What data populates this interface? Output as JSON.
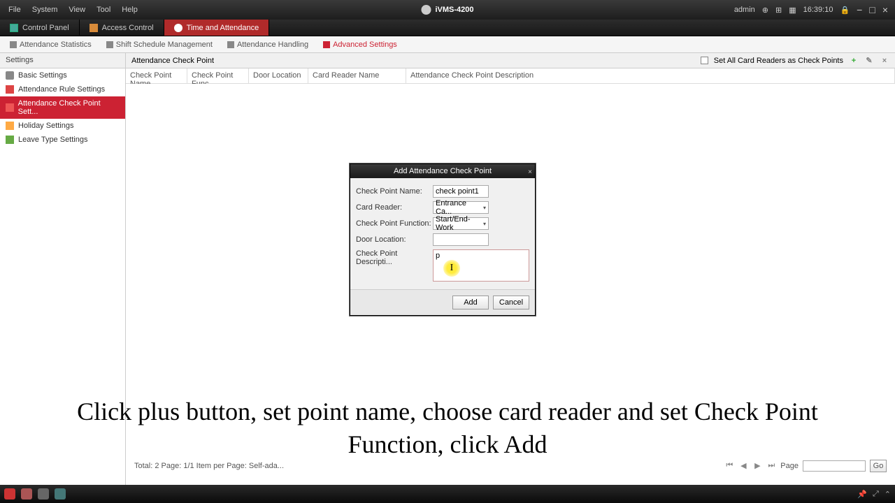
{
  "menubar": {
    "items": [
      "File",
      "System",
      "View",
      "Tool",
      "Help"
    ],
    "app_title": "iVMS-4200",
    "user": "admin",
    "time": "16:39:10"
  },
  "main_tabs": [
    {
      "label": "Control Panel",
      "active": false
    },
    {
      "label": "Access Control",
      "active": false
    },
    {
      "label": "Time and Attendance",
      "active": true
    }
  ],
  "sub_tabs": [
    {
      "label": "Attendance Statistics",
      "active": false
    },
    {
      "label": "Shift Schedule Management",
      "active": false
    },
    {
      "label": "Attendance Handling",
      "active": false
    },
    {
      "label": "Advanced Settings",
      "active": true
    }
  ],
  "sidebar": {
    "header": "Settings",
    "items": [
      {
        "label": "Basic Settings",
        "icon": "si-basic"
      },
      {
        "label": "Attendance Rule Settings",
        "icon": "si-rule"
      },
      {
        "label": "Attendance Check Point Sett...",
        "icon": "si-check",
        "selected": true
      },
      {
        "label": "Holiday Settings",
        "icon": "si-holiday"
      },
      {
        "label": "Leave Type Settings",
        "icon": "si-leave"
      }
    ]
  },
  "main": {
    "title": "Attendance Check Point",
    "set_all": "Set All Card Readers as Check Points",
    "columns": [
      "Check Point Name",
      "Check Point Func...",
      "Door Location",
      "Card Reader Name",
      "Attendance Check Point Description"
    ]
  },
  "status": {
    "left": "Total: 2  Page: 1/1  Item per Page:  Self-ada...",
    "page_label": "Page",
    "go": "Go"
  },
  "dialog": {
    "title": "Add Attendance Check Point",
    "fields": {
      "name_label": "Check Point Name:",
      "name_value": "check point1",
      "reader_label": "Card Reader:",
      "reader_value": "Entrance Ca...",
      "func_label": "Check Point Function:",
      "func_value": "Start/End-Work",
      "door_label": "Door Location:",
      "door_value": "",
      "desc_label": "Check Point Descripti...",
      "desc_value": "p"
    },
    "add": "Add",
    "cancel": "Cancel"
  },
  "instruction": "Click plus button, set point name, choose card reader and set Check Point Function, click Add"
}
